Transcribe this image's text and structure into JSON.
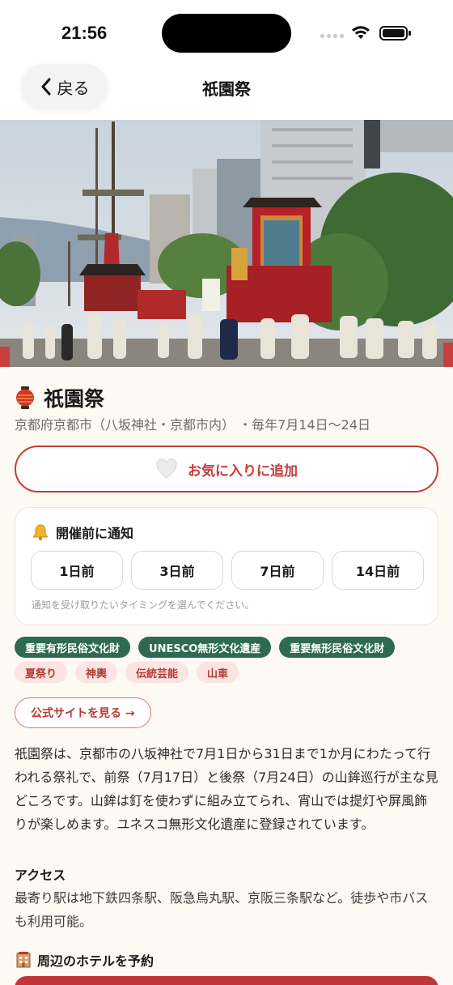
{
  "status_bar": {
    "time": "21:56"
  },
  "nav": {
    "back_label": "戻る",
    "title": "祇園祭"
  },
  "event": {
    "emoji": "🏮",
    "name": "祇園祭",
    "location": "京都府京都市（八坂神社・京都市内）",
    "dates": "・毎年7月14日〜24日"
  },
  "favorite": {
    "label": "お気に入りに追加",
    "icon": "heart-icon"
  },
  "notify": {
    "heading": "開催前に通知",
    "icon": "bell-icon",
    "options": [
      "1日前",
      "3日前",
      "7日前",
      "14日前"
    ],
    "hint": "通知を受け取りたいタイミングを選んでください。"
  },
  "tags": {
    "heritage": [
      "重要有形民俗文化財",
      "UNESCO無形文化遺産",
      "重要無形民俗文化財"
    ],
    "categories": [
      "夏祭り",
      "神輿",
      "伝統芸能",
      "山車"
    ]
  },
  "site_button": {
    "label": "公式サイトを見る →"
  },
  "description": "祇園祭は、京都市の八坂神社で7月1日から31日まで1か月にわたって行われる祭礼で、前祭（7月17日）と後祭（7月24日）の山鉾巡行が主な見どころです。山鉾は釘を使わずに組み立てられ、宵山では提灯や屏風飾りが楽しめます。ユネスコ無形文化遺産に登録されています。",
  "access": {
    "heading": "アクセス",
    "text": "最寄り駅は地下鉄四条駅、阪急烏丸駅、京阪三条駅など。徒歩や市バスも利用可能。"
  },
  "hotel": {
    "heading": "周辺のホテルを予約",
    "icon": "hotel-icon"
  },
  "colors": {
    "accent": "#c63a3a",
    "green": "#2e6a4f",
    "pink_bg": "#fbe4e2",
    "background": "#fdf9f3"
  }
}
